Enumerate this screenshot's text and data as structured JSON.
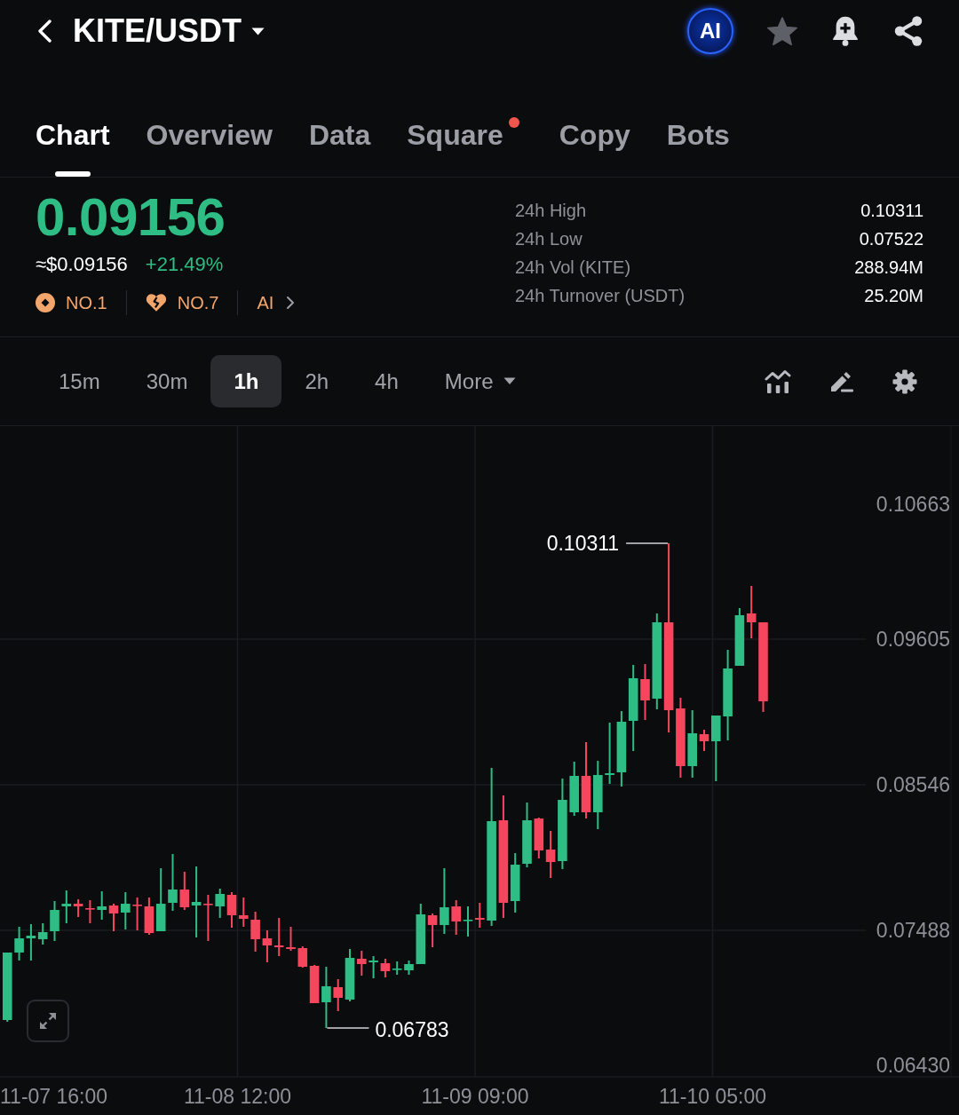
{
  "header": {
    "title": "KITE/USDT",
    "ai_button": "AI"
  },
  "tabs": [
    {
      "label": "Chart",
      "selected": true,
      "has_dot": false
    },
    {
      "label": "Overview",
      "selected": false,
      "has_dot": false
    },
    {
      "label": "Data",
      "selected": false,
      "has_dot": false
    },
    {
      "label": "Square",
      "selected": false,
      "has_dot": true
    },
    {
      "label": "Copy",
      "selected": false,
      "has_dot": false
    },
    {
      "label": "Bots",
      "selected": false,
      "has_dot": false
    }
  ],
  "ticker": {
    "price": "0.09156",
    "rising": true,
    "usd_price": "≈$0.09156",
    "change": "+21.49%",
    "rankings": [
      {
        "kind": "rank",
        "label": "NO.1"
      },
      {
        "kind": "hot",
        "label": "NO.7"
      },
      {
        "kind": "link",
        "label": "AI"
      }
    ]
  },
  "stats": [
    {
      "label": "24h High",
      "value": "0.10311"
    },
    {
      "label": "24h Low",
      "value": "0.07522"
    },
    {
      "label": "24h Vol (KITE)",
      "value": "288.94M"
    },
    {
      "label": "24h Turnover (USDT)",
      "value": "25.20M"
    }
  ],
  "toolbar": {
    "intervals": [
      {
        "label": "15m",
        "selected": false
      },
      {
        "label": "30m",
        "selected": false
      },
      {
        "label": "1h",
        "selected": true
      },
      {
        "label": "2h",
        "selected": false
      },
      {
        "label": "4h",
        "selected": false
      }
    ],
    "more": "More"
  },
  "chart": {
    "price_axis": [
      "0.10663",
      "0.09605",
      "0.08546",
      "0.07488",
      "0.06430"
    ],
    "time_axis": [
      "11-07 16:00",
      "11-08 12:00",
      "11-09 09:00",
      "11-10 05:00"
    ],
    "high_marker": "0.10311",
    "low_marker": "0.06783"
  }
}
